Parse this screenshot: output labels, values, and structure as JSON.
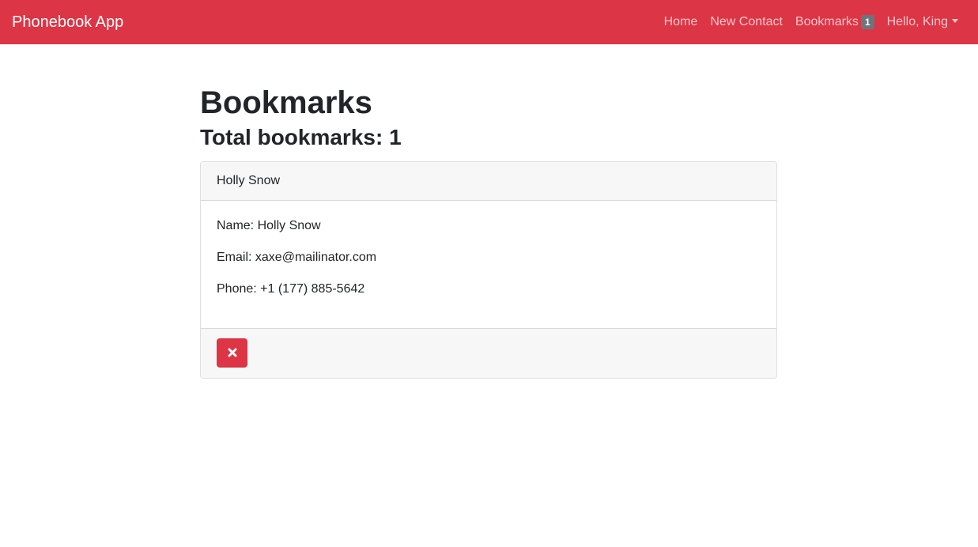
{
  "navbar": {
    "brand": "Phonebook App",
    "links": {
      "home": "Home",
      "new_contact": "New Contact",
      "bookmarks": "Bookmarks",
      "bookmarks_count": "1",
      "user": "Hello, King"
    },
    "bg_color": "#dc3545"
  },
  "page": {
    "title": "Bookmarks",
    "subtitle": "Total bookmarks: 1"
  },
  "bookmarks": [
    {
      "header": "Holly Snow",
      "name": "Name: Holly Snow",
      "email": "Email: xaxe@mailinator.com",
      "phone": "Phone: +1 (177) 885-5642",
      "delete_icon": "close-icon"
    }
  ]
}
